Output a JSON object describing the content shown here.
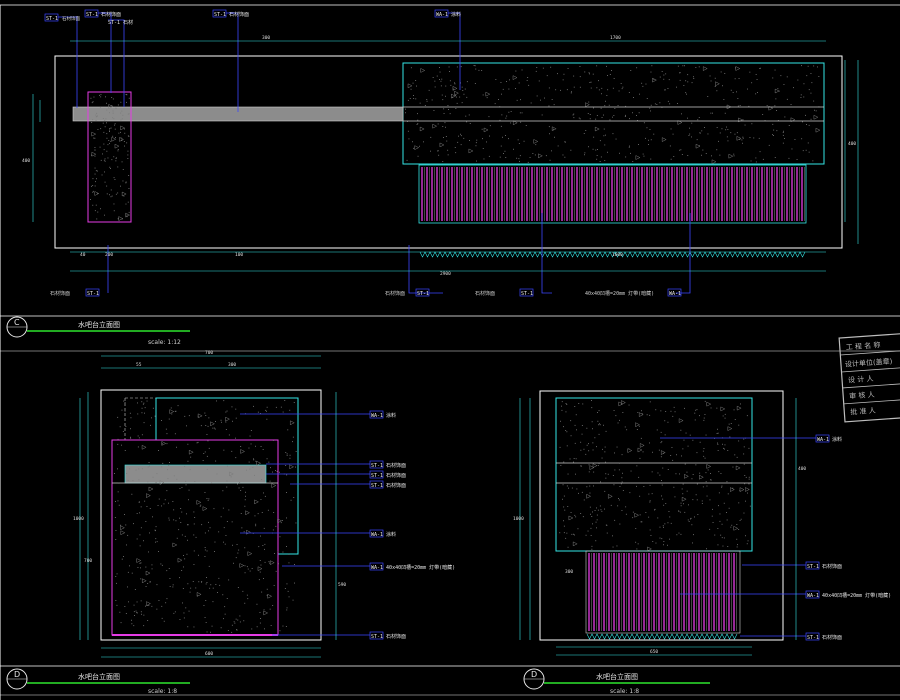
{
  "elev_c": {
    "bubble": "C",
    "title": "水吧台立面图",
    "scale": "scale: 1:12",
    "top_tags": [
      "ST-1",
      "ST-1 石材饰面",
      "ST-1 石材",
      "ST-1 石材饰面",
      "WA-1 涂料"
    ],
    "bottom_labels": [
      "石材饰面",
      "ST-1",
      "石材饰面",
      "ST-1",
      "石材饰面",
      "ST-1",
      "40x40凹槽=20mm 灯带(暗藏)",
      "WA-1"
    ],
    "left_dims": [
      "40",
      "25",
      "400",
      "730"
    ],
    "top_dims": [
      "300",
      "300",
      "1700"
    ],
    "bottom_dims": [
      "40",
      "200",
      "100",
      "1600",
      "40",
      "2900"
    ],
    "right_dims": [
      "130",
      "50",
      "400",
      "800"
    ]
  },
  "elev_d": {
    "bubble": "D",
    "title": "水吧台立面图",
    "scale": "scale: 1:8",
    "tags": [
      "WA-1 涂料",
      "ST-1 石材饰面",
      "ST-1 石材饰面",
      "ST-1 石材饰面",
      "WA-1 涂料",
      "WA-1 40x40凹槽=20mm 灯带(暗藏)",
      "ST-1 石材饰面"
    ],
    "top_dims": [
      "700",
      "55",
      "100",
      "300"
    ],
    "left_dims": [
      "1000",
      "700"
    ],
    "right_dims": [
      "100",
      "50",
      "30",
      "590"
    ],
    "bottom_dims": [
      "100",
      "600",
      "30",
      "100"
    ]
  },
  "elev_e": {
    "bubble": "D",
    "title": "水吧台立面图",
    "scale": "scale: 1:8",
    "tags": [
      "WA-1 涂料",
      "ST-1 石材饰面",
      "WA-1 40x40凹槽=20mm 灯带(暗藏)",
      "ST-1 石材饰面"
    ],
    "left_dims": [
      "1000",
      "400",
      "15",
      "300"
    ],
    "right_dims": [
      "400",
      "40",
      "400",
      "40"
    ],
    "bottom_dims": [
      "100",
      "650",
      "40"
    ]
  },
  "stamp": {
    "rows": [
      "工 程 名 称",
      "设计单位(盖章)",
      "设 计 人",
      "审 核 人",
      "批 准 人"
    ]
  },
  "colors": {
    "background": "#000000",
    "outline": "#ffffff",
    "cyan": "#35e6e6",
    "magenta": "#e63ce6",
    "blue": "#3b46ff",
    "green": "#2ee62e",
    "fill_gray": "#8c8c8c",
    "text": "#d8d8d8"
  }
}
